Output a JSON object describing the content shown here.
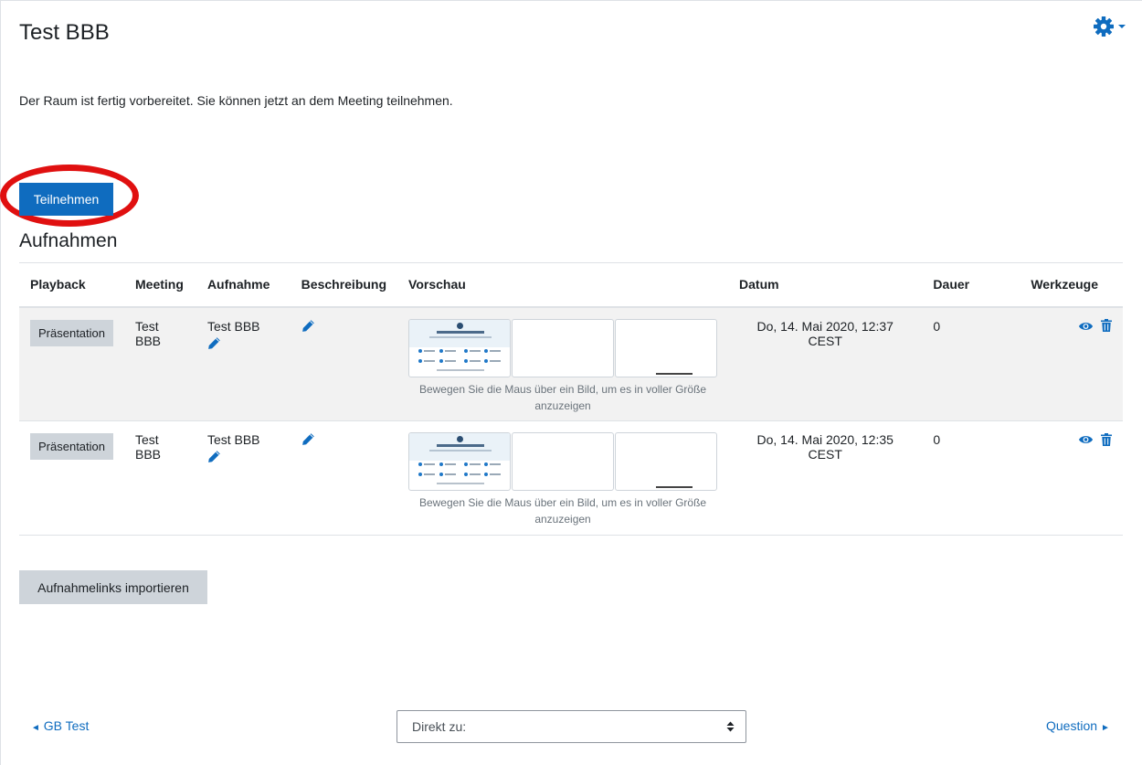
{
  "page": {
    "title": "Test BBB",
    "status_message": "Der Raum ist fertig vorbereitet. Sie können jetzt an dem Meeting teilnehmen.",
    "join_label": "Teilnehmen",
    "recordings_heading": "Aufnahmen"
  },
  "table": {
    "headers": {
      "playback": "Playback",
      "meeting": "Meeting",
      "recording": "Aufnahme",
      "description": "Beschreibung",
      "preview": "Vorschau",
      "date": "Datum",
      "duration": "Dauer",
      "tools": "Werkzeuge"
    },
    "rows": [
      {
        "playback": "Präsentation",
        "meeting": "Test BBB",
        "recording": "Test BBB",
        "preview_hint": "Bewegen Sie die Maus über ein Bild, um es in voller Größe anzuzeigen",
        "date": "Do, 14. Mai 2020, 12:37 CEST",
        "duration": "0"
      },
      {
        "playback": "Präsentation",
        "meeting": "Test BBB",
        "recording": "Test BBB",
        "preview_hint": "Bewegen Sie die Maus über ein Bild, um es in voller Größe anzuzeigen",
        "date": "Do, 14. Mai 2020, 12:35 CEST",
        "duration": "0"
      }
    ]
  },
  "import_label": "Aufnahmelinks importieren",
  "footer": {
    "prev_label": "GB Test",
    "jump_label": "Direkt zu:",
    "next_label": "Question"
  },
  "icons": {
    "settings": "gear-icon",
    "edit": "pencil-icon",
    "view": "eye-icon",
    "delete": "trash-icon"
  },
  "colors": {
    "primary": "#0f6cbf",
    "secondary_button": "#ced4da",
    "highlight_ring": "#e01010",
    "row_stripe": "#f2f2f2"
  }
}
